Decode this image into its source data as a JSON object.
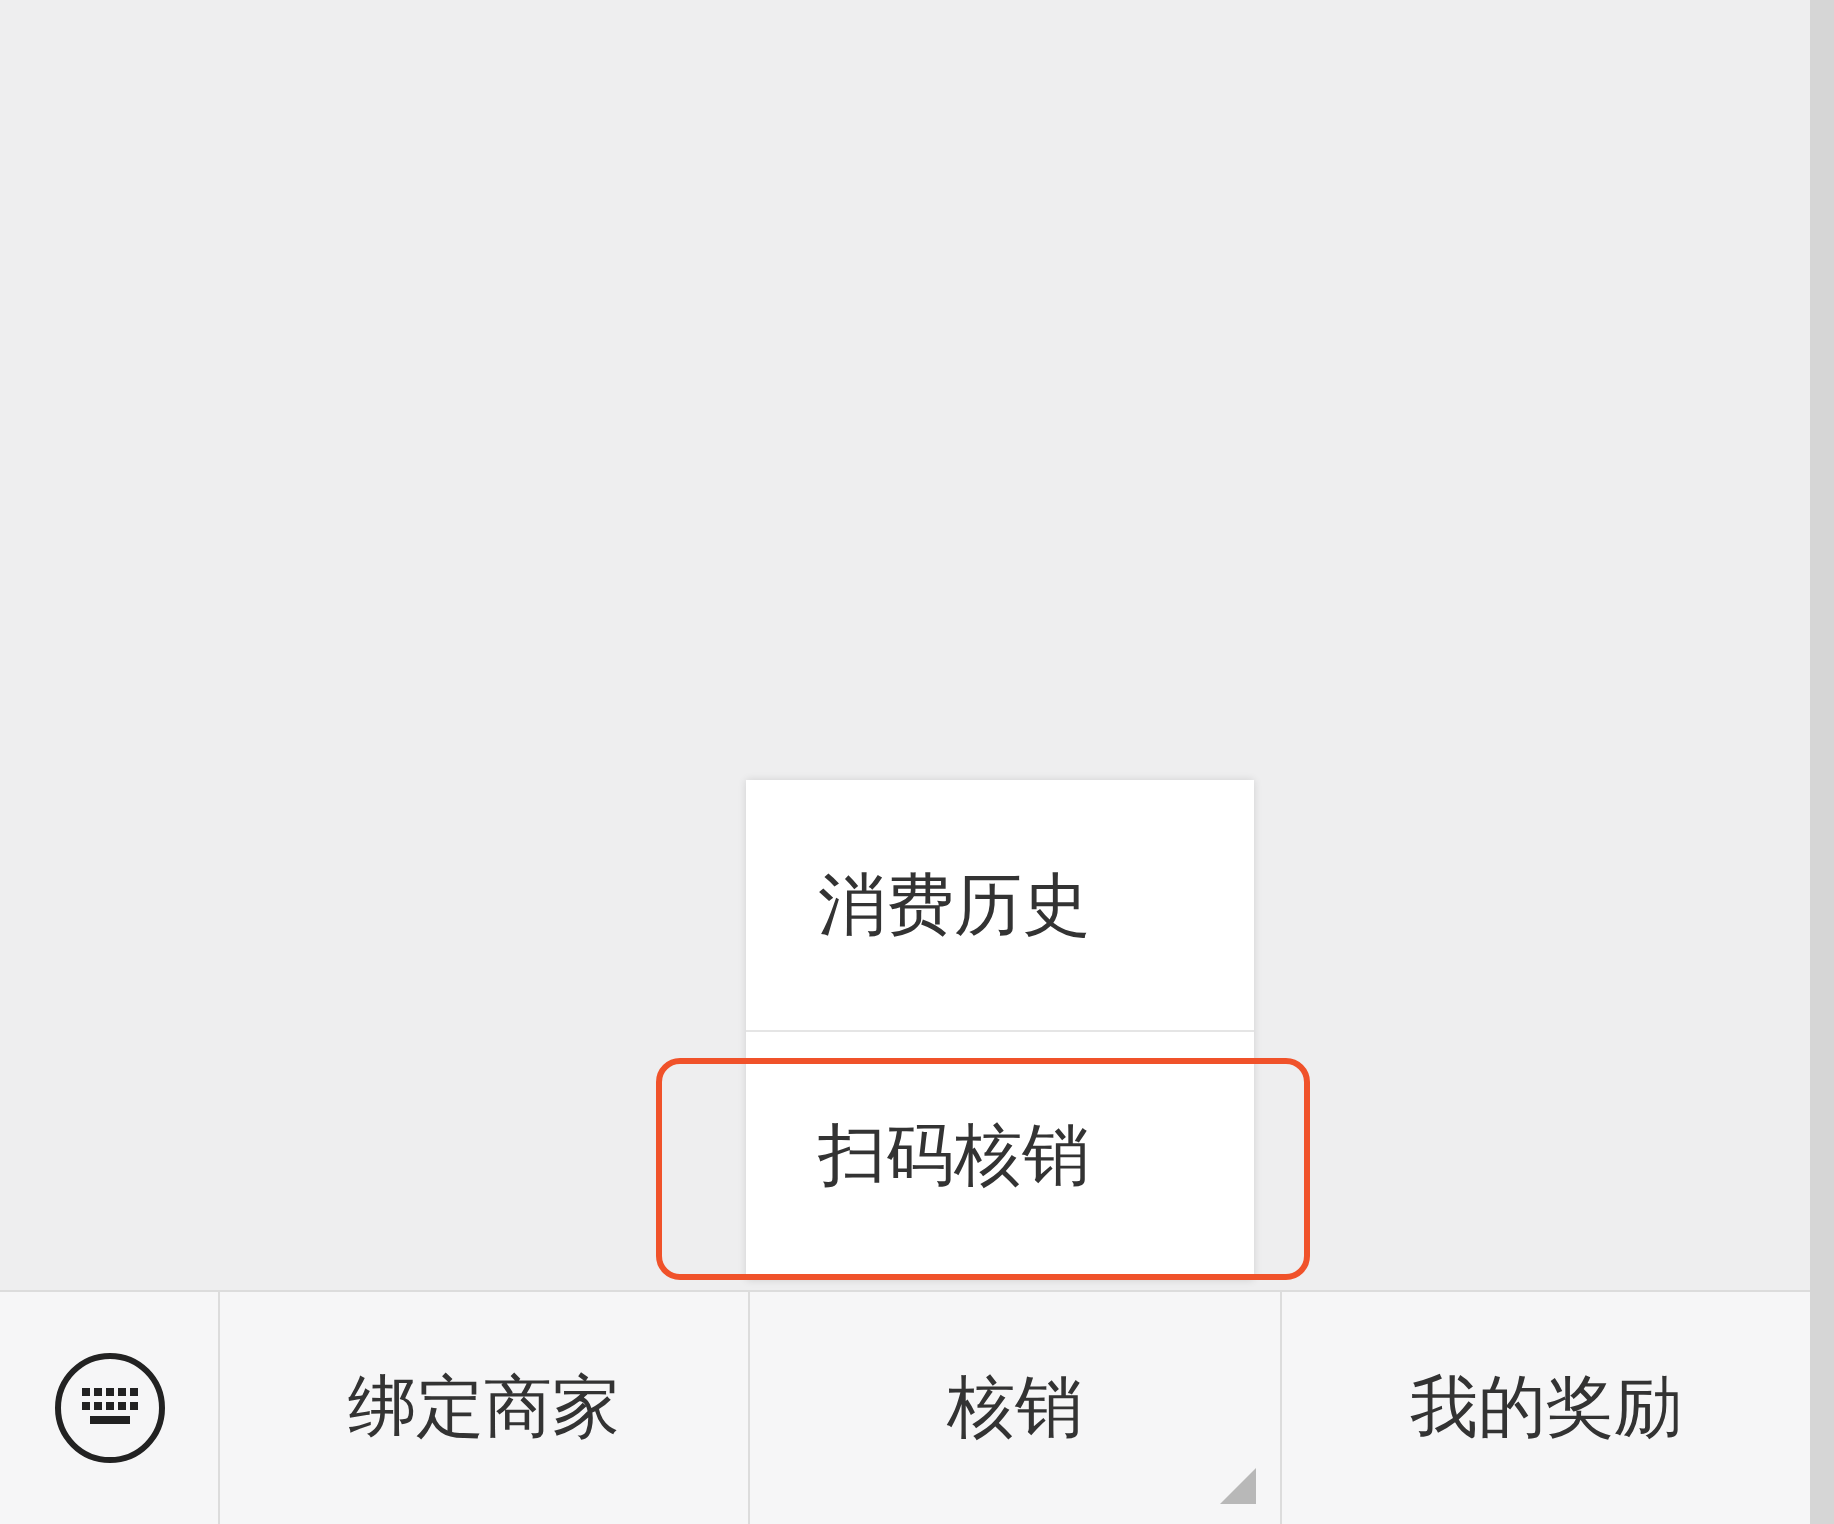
{
  "popup_menu": {
    "items": [
      {
        "label": "消费历史",
        "highlighted": false
      },
      {
        "label": "扫码核销",
        "highlighted": true
      }
    ]
  },
  "bottom_menu": {
    "tabs": [
      {
        "label": "绑定商家",
        "kind": "plain"
      },
      {
        "label": "核销",
        "kind": "submenu"
      },
      {
        "label": "我的奖励",
        "kind": "plain"
      }
    ]
  }
}
